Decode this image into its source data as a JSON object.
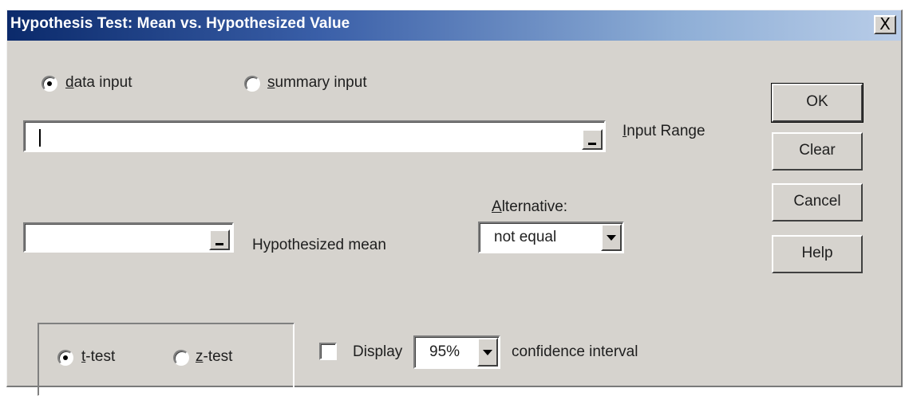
{
  "dialog": {
    "title": "Hypothesis Test: Mean vs. Hypothesized Value",
    "close_glyph": "X"
  },
  "input_mode": {
    "data_input_label": "data input",
    "summary_input_label": "summary input",
    "selected": "data input"
  },
  "input_range": {
    "label": "Input Range",
    "value": ""
  },
  "hypothesized_mean": {
    "label": "Hypothesized mean",
    "value": ""
  },
  "alternative": {
    "label": "Alternative:",
    "selected": "not equal"
  },
  "test_type": {
    "t_label": "t-test",
    "z_label": "z-test",
    "selected": "t-test"
  },
  "confidence": {
    "display_label": "Display",
    "display_checked": false,
    "level": "95%",
    "suffix_label": "confidence interval"
  },
  "buttons": {
    "ok": "OK",
    "clear": "Clear",
    "cancel": "Cancel",
    "help": "Help"
  },
  "icons": {
    "close": "close-icon",
    "range_picker": "range-picker-icon",
    "dropdown": "chevron-down-icon"
  },
  "colors": {
    "title_bar_start": "#0b2a6b",
    "title_bar_end": "#b9cde8",
    "dialog_face": "#d6d3ce"
  }
}
